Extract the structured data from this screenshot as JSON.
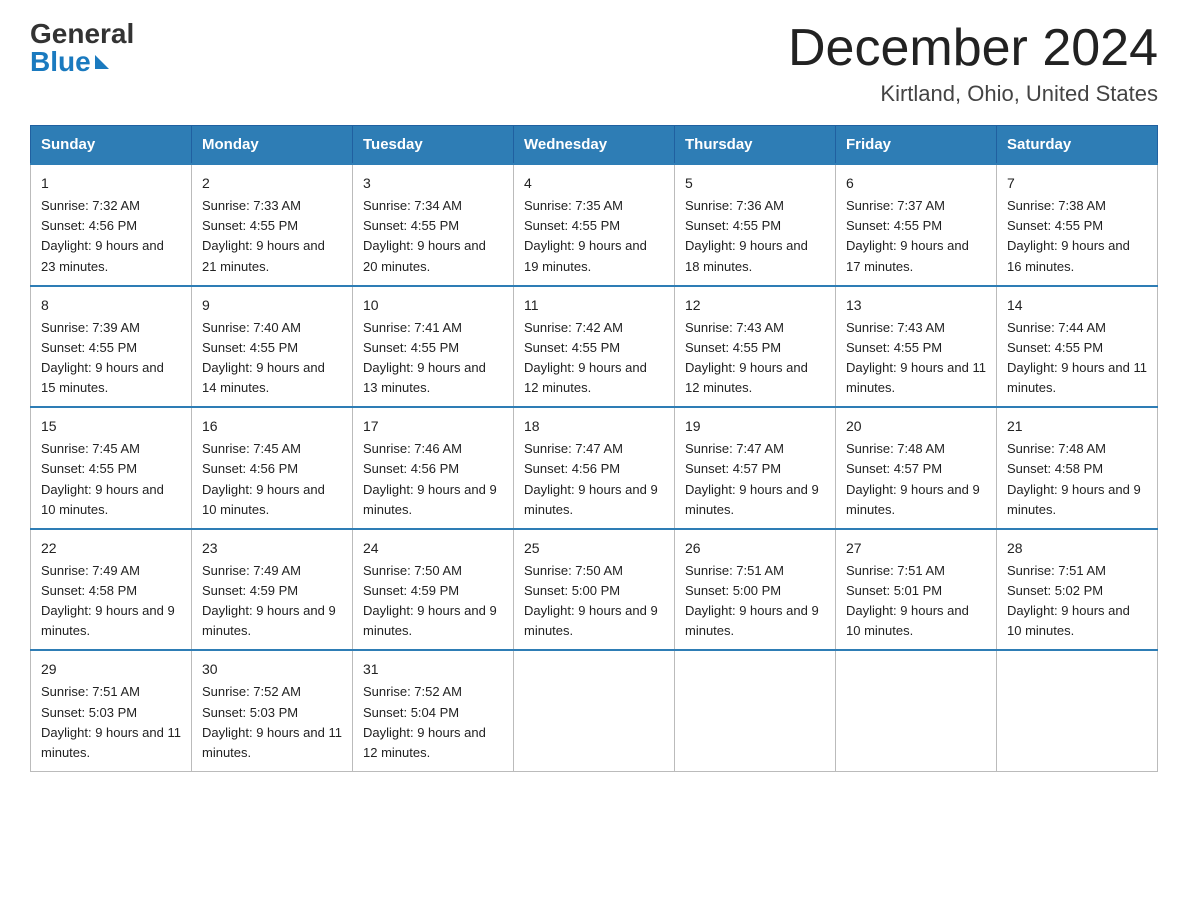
{
  "logo": {
    "general": "General",
    "blue": "Blue"
  },
  "title": "December 2024",
  "location": "Kirtland, Ohio, United States",
  "days_of_week": [
    "Sunday",
    "Monday",
    "Tuesday",
    "Wednesday",
    "Thursday",
    "Friday",
    "Saturday"
  ],
  "weeks": [
    [
      {
        "date": "1",
        "sunrise": "7:32 AM",
        "sunset": "4:56 PM",
        "daylight": "9 hours and 23 minutes."
      },
      {
        "date": "2",
        "sunrise": "7:33 AM",
        "sunset": "4:55 PM",
        "daylight": "9 hours and 21 minutes."
      },
      {
        "date": "3",
        "sunrise": "7:34 AM",
        "sunset": "4:55 PM",
        "daylight": "9 hours and 20 minutes."
      },
      {
        "date": "4",
        "sunrise": "7:35 AM",
        "sunset": "4:55 PM",
        "daylight": "9 hours and 19 minutes."
      },
      {
        "date": "5",
        "sunrise": "7:36 AM",
        "sunset": "4:55 PM",
        "daylight": "9 hours and 18 minutes."
      },
      {
        "date": "6",
        "sunrise": "7:37 AM",
        "sunset": "4:55 PM",
        "daylight": "9 hours and 17 minutes."
      },
      {
        "date": "7",
        "sunrise": "7:38 AM",
        "sunset": "4:55 PM",
        "daylight": "9 hours and 16 minutes."
      }
    ],
    [
      {
        "date": "8",
        "sunrise": "7:39 AM",
        "sunset": "4:55 PM",
        "daylight": "9 hours and 15 minutes."
      },
      {
        "date": "9",
        "sunrise": "7:40 AM",
        "sunset": "4:55 PM",
        "daylight": "9 hours and 14 minutes."
      },
      {
        "date": "10",
        "sunrise": "7:41 AM",
        "sunset": "4:55 PM",
        "daylight": "9 hours and 13 minutes."
      },
      {
        "date": "11",
        "sunrise": "7:42 AM",
        "sunset": "4:55 PM",
        "daylight": "9 hours and 12 minutes."
      },
      {
        "date": "12",
        "sunrise": "7:43 AM",
        "sunset": "4:55 PM",
        "daylight": "9 hours and 12 minutes."
      },
      {
        "date": "13",
        "sunrise": "7:43 AM",
        "sunset": "4:55 PM",
        "daylight": "9 hours and 11 minutes."
      },
      {
        "date": "14",
        "sunrise": "7:44 AM",
        "sunset": "4:55 PM",
        "daylight": "9 hours and 11 minutes."
      }
    ],
    [
      {
        "date": "15",
        "sunrise": "7:45 AM",
        "sunset": "4:55 PM",
        "daylight": "9 hours and 10 minutes."
      },
      {
        "date": "16",
        "sunrise": "7:45 AM",
        "sunset": "4:56 PM",
        "daylight": "9 hours and 10 minutes."
      },
      {
        "date": "17",
        "sunrise": "7:46 AM",
        "sunset": "4:56 PM",
        "daylight": "9 hours and 9 minutes."
      },
      {
        "date": "18",
        "sunrise": "7:47 AM",
        "sunset": "4:56 PM",
        "daylight": "9 hours and 9 minutes."
      },
      {
        "date": "19",
        "sunrise": "7:47 AM",
        "sunset": "4:57 PM",
        "daylight": "9 hours and 9 minutes."
      },
      {
        "date": "20",
        "sunrise": "7:48 AM",
        "sunset": "4:57 PM",
        "daylight": "9 hours and 9 minutes."
      },
      {
        "date": "21",
        "sunrise": "7:48 AM",
        "sunset": "4:58 PM",
        "daylight": "9 hours and 9 minutes."
      }
    ],
    [
      {
        "date": "22",
        "sunrise": "7:49 AM",
        "sunset": "4:58 PM",
        "daylight": "9 hours and 9 minutes."
      },
      {
        "date": "23",
        "sunrise": "7:49 AM",
        "sunset": "4:59 PM",
        "daylight": "9 hours and 9 minutes."
      },
      {
        "date": "24",
        "sunrise": "7:50 AM",
        "sunset": "4:59 PM",
        "daylight": "9 hours and 9 minutes."
      },
      {
        "date": "25",
        "sunrise": "7:50 AM",
        "sunset": "5:00 PM",
        "daylight": "9 hours and 9 minutes."
      },
      {
        "date": "26",
        "sunrise": "7:51 AM",
        "sunset": "5:00 PM",
        "daylight": "9 hours and 9 minutes."
      },
      {
        "date": "27",
        "sunrise": "7:51 AM",
        "sunset": "5:01 PM",
        "daylight": "9 hours and 10 minutes."
      },
      {
        "date": "28",
        "sunrise": "7:51 AM",
        "sunset": "5:02 PM",
        "daylight": "9 hours and 10 minutes."
      }
    ],
    [
      {
        "date": "29",
        "sunrise": "7:51 AM",
        "sunset": "5:03 PM",
        "daylight": "9 hours and 11 minutes."
      },
      {
        "date": "30",
        "sunrise": "7:52 AM",
        "sunset": "5:03 PM",
        "daylight": "9 hours and 11 minutes."
      },
      {
        "date": "31",
        "sunrise": "7:52 AM",
        "sunset": "5:04 PM",
        "daylight": "9 hours and 12 minutes."
      },
      {
        "date": "",
        "sunrise": "",
        "sunset": "",
        "daylight": ""
      },
      {
        "date": "",
        "sunrise": "",
        "sunset": "",
        "daylight": ""
      },
      {
        "date": "",
        "sunrise": "",
        "sunset": "",
        "daylight": ""
      },
      {
        "date": "",
        "sunrise": "",
        "sunset": "",
        "daylight": ""
      }
    ]
  ],
  "labels": {
    "sunrise_prefix": "Sunrise: ",
    "sunset_prefix": "Sunset: ",
    "daylight_prefix": "Daylight: "
  }
}
